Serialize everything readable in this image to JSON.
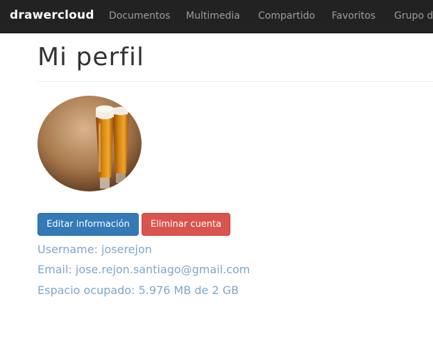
{
  "navbar": {
    "brand": "drawercloud",
    "links": [
      "Documentos",
      "Multimedia",
      "Compartido",
      "Favoritos",
      "Grupo de"
    ]
  },
  "page": {
    "title": "Mi perfil"
  },
  "avatar": {
    "icon": "beer-glasses-photo"
  },
  "actions": {
    "edit_label": "Editar información",
    "delete_label": "Eliminar cuenta"
  },
  "profile": {
    "username": "Username: joserejon",
    "email": "Email: jose.rejon.santiago@gmail.com",
    "storage": "Espacio ocupado: 5.976 MB de 2 GB"
  },
  "colors": {
    "navbar_bg": "#222222",
    "primary": "#337ab7",
    "danger": "#d9534f",
    "info_text": "#7fa6c8"
  }
}
